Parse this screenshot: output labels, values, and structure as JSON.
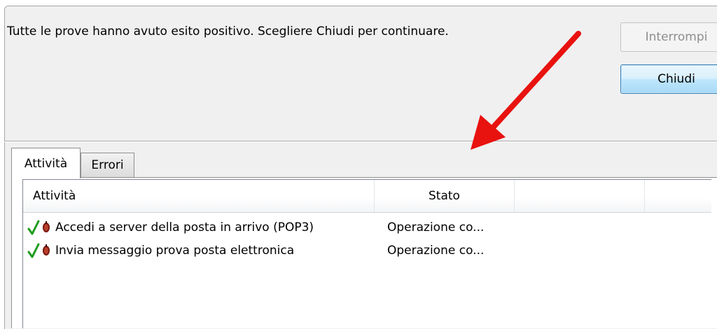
{
  "message": "Tutte le prove hanno avuto esito positivo. Scegliere Chiudi per continuare.",
  "buttons": {
    "interrompi": "Interrompi",
    "chiudi": "Chiudi"
  },
  "tabs": [
    {
      "label": "Attività",
      "selected": true
    },
    {
      "label": "Errori",
      "selected": false
    }
  ],
  "table": {
    "columns": [
      "Attività",
      "Stato",
      "",
      ""
    ],
    "rows": [
      {
        "task": "Accedi a server della posta in arrivo (POP3)",
        "status": "Operazione co...",
        "icon": "check-success-icon"
      },
      {
        "task": "Invia messaggio prova posta elettronica",
        "status": "Operazione co...",
        "icon": "check-success-icon"
      }
    ]
  },
  "colors": {
    "annotation_arrow": "#e8120f",
    "check": "#1e9b1e",
    "bug": "#7a1a10"
  }
}
